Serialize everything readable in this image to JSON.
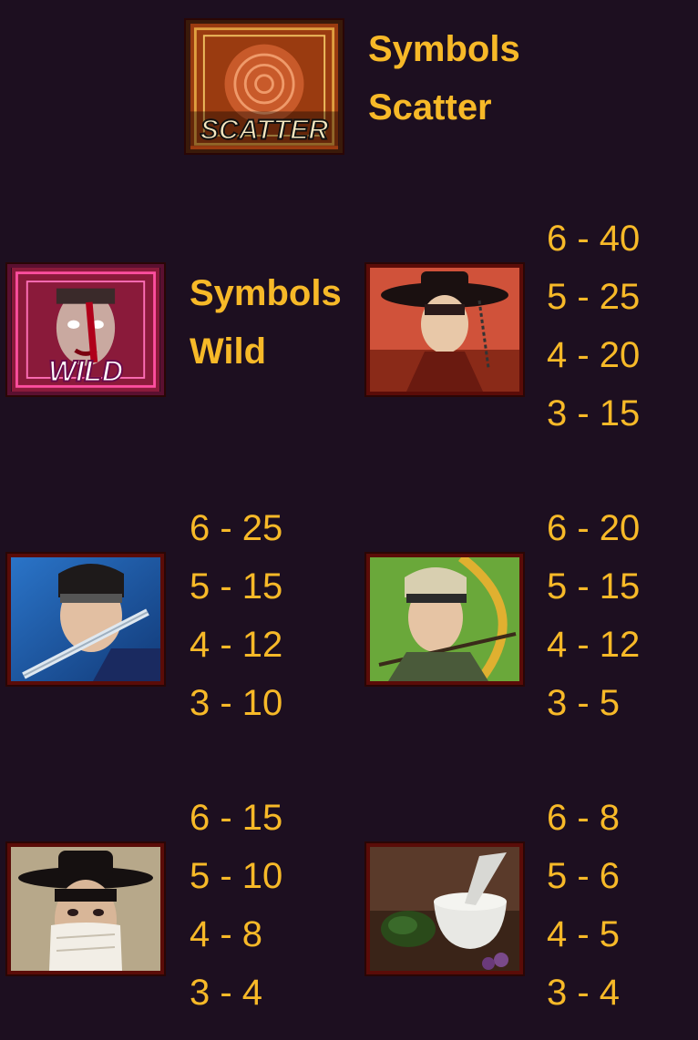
{
  "scatter": {
    "line1": "Symbols",
    "line2": "Scatter",
    "badge": "SCATTER",
    "icon": "scatter-target-icon"
  },
  "wild": {
    "line1": "Symbols",
    "line2": "Wild",
    "badge": "WILD",
    "icon": "zombie-wild-icon"
  },
  "symbols": [
    {
      "icon": "official-hat-man-icon",
      "pays": [
        "6 - 40",
        "5 - 25",
        "4 - 20",
        "3 - 15"
      ]
    },
    {
      "icon": "swordsman-icon",
      "pays": [
        "6 - 25",
        "5 - 15",
        "4 - 12",
        "3 - 10"
      ]
    },
    {
      "icon": "archer-icon",
      "pays": [
        "6 - 20",
        "5 - 15",
        "4 - 12",
        "3 - 5"
      ]
    },
    {
      "icon": "masked-guard-icon",
      "pays": [
        "6 - 15",
        "5 - 10",
        "4 - 8",
        "3 - 4"
      ]
    },
    {
      "icon": "mortar-herbs-icon",
      "pays": [
        "6 - 8",
        "5 - 6",
        "4 - 5",
        "3 - 4"
      ]
    }
  ],
  "colors": {
    "background": "#1d0f20",
    "text": "#f7b928",
    "frame": "#5a0c08"
  }
}
